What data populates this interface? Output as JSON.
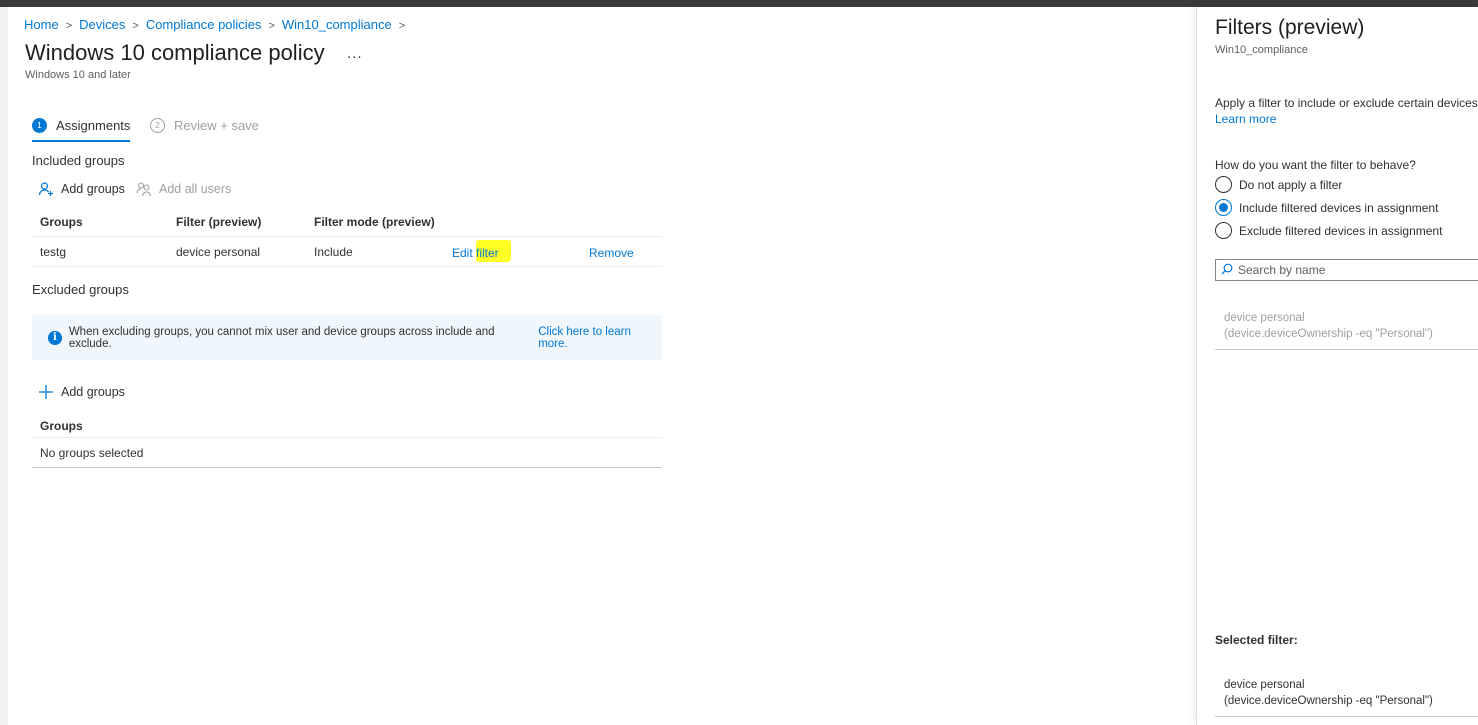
{
  "breadcrumb": [
    "Home",
    "Devices",
    "Compliance policies",
    "Win10_compliance"
  ],
  "page": {
    "title": "Windows 10 compliance policy",
    "more": "...",
    "subtitle": "Windows 10 and later"
  },
  "tabs": [
    {
      "num": "1",
      "label": "Assignments"
    },
    {
      "num": "2",
      "label": "Review + save"
    }
  ],
  "included": {
    "heading": "Included groups",
    "add_groups": "Add groups",
    "add_all_users": "Add all users",
    "columns": [
      "Groups",
      "Filter (preview)",
      "Filter mode (preview)"
    ],
    "rows": [
      {
        "group": "testg",
        "filter": "device personal",
        "mode": "Include",
        "edit": "Edit filter",
        "remove": "Remove"
      }
    ]
  },
  "excluded": {
    "heading": "Excluded groups",
    "info_text": "When excluding groups, you cannot mix user and device groups across include and exclude.",
    "info_link": "Click here to learn more.",
    "add_groups": "Add groups",
    "column": "Groups",
    "empty": "No groups selected"
  },
  "panel": {
    "title": "Filters (preview)",
    "subtitle": "Win10_compliance",
    "description": "Apply a filter to include or exclude certain devices f",
    "learn_more": "Learn more",
    "question": "How do you want the filter to behave?",
    "options": [
      "Do not apply a filter",
      "Include filtered devices in assignment",
      "Exclude filtered devices in assignment"
    ],
    "selected_option": 1,
    "search_placeholder": "Search by name",
    "result": {
      "name": "device personal",
      "rule": "(device.deviceOwnership -eq \"Personal\")"
    },
    "selected_label": "Selected filter:",
    "selected": {
      "name": "device personal",
      "rule": "(device.deviceOwnership -eq \"Personal\")"
    }
  },
  "colors": {
    "accent": "#0078d4",
    "highlight": "#ffff00",
    "info_bg": "#eff6fc"
  }
}
